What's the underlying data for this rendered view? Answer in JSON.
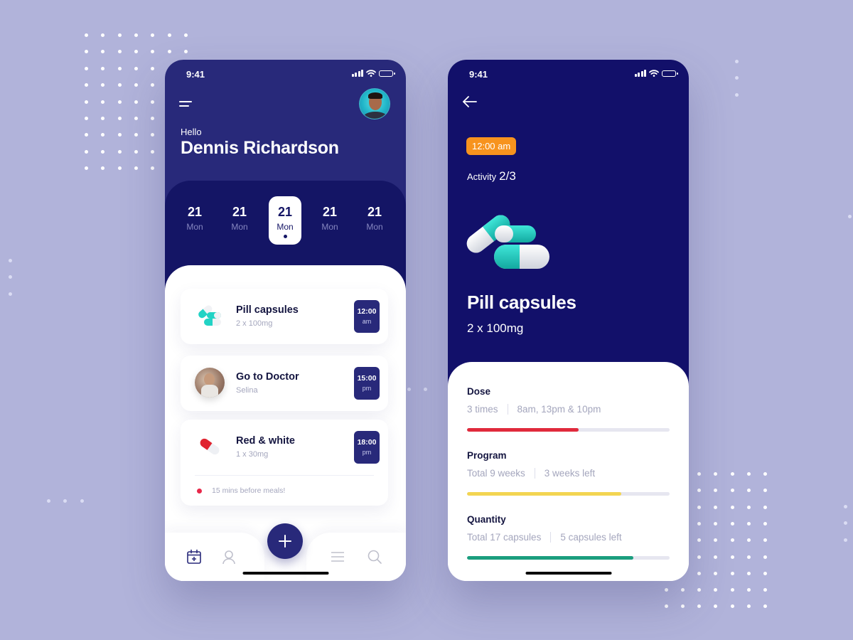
{
  "colors": {
    "background": "#b1b3da",
    "primary_navy": "#28297a",
    "deep_navy": "#12106a",
    "accent_orange": "#f7931e",
    "dose_bar": "#e02a3c",
    "program_bar": "#f3d552",
    "quantity_bar": "#1b9e7e",
    "alert_red": "#e8284a",
    "pill_teal": "#22d3c5"
  },
  "phone_home": {
    "status_bar": {
      "time": "9:41",
      "icons": [
        "signal-icon",
        "wifi-icon",
        "battery-icon"
      ]
    },
    "greeting": "Hello",
    "user_name": "Dennis Richardson",
    "calendar": [
      {
        "num": "21",
        "day": "Mon",
        "selected": false
      },
      {
        "num": "21",
        "day": "Mon",
        "selected": false
      },
      {
        "num": "21",
        "day": "Mon",
        "selected": true
      },
      {
        "num": "21",
        "day": "Mon",
        "selected": false
      },
      {
        "num": "21",
        "day": "Mon",
        "selected": false
      }
    ],
    "tasks": [
      {
        "title": "Pill capsules",
        "subtitle": "2 x 100mg",
        "time": "12:00",
        "ampm": "am",
        "icon": "capsules-icon"
      },
      {
        "title": "Go to Doctor",
        "subtitle": "Selina",
        "time": "15:00",
        "ampm": "pm",
        "icon": "doctor-avatar"
      },
      {
        "title": "Red & white",
        "subtitle": "1 x 30mg",
        "time": "18:00",
        "ampm": "pm",
        "icon": "red-pill-icon",
        "note": "15 mins before meals!"
      }
    ],
    "tab_bar": {
      "items": [
        "calendar-icon",
        "profile-icon",
        "add-icon",
        "list-icon",
        "search-icon"
      ],
      "active": "calendar-icon"
    }
  },
  "phone_detail": {
    "status_bar": {
      "time": "9:41"
    },
    "time_pill": "12:00 am",
    "activity_label": "Activity",
    "activity_value": "2/3",
    "title": "Pill capsules",
    "subtitle": "2 x 100mg",
    "sections": [
      {
        "title": "Dose",
        "left": "3 times",
        "right": "8am, 13pm & 10pm",
        "progress": 0.55,
        "color": "#e02a3c"
      },
      {
        "title": "Program",
        "left": "Total 9 weeks",
        "right": "3 weeks left",
        "progress": 0.76,
        "color": "#f3d552"
      },
      {
        "title": "Quantity",
        "left": "Total 17 capsules",
        "right": "5 capsules left",
        "progress": 0.82,
        "color": "#1b9e7e"
      }
    ]
  }
}
